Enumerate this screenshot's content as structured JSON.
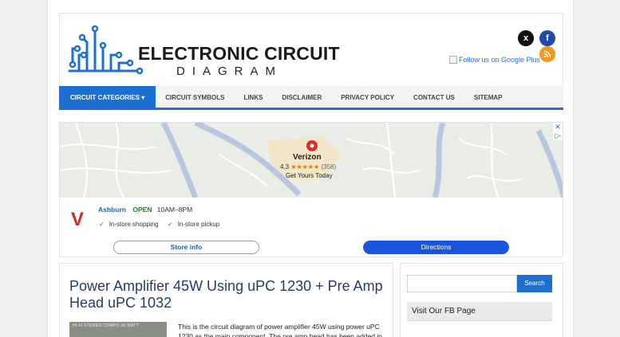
{
  "brand": {
    "title": "ELECTRONIC CIRCUIT",
    "subtitle": "DIAGRAM"
  },
  "social": {
    "twitter_icon": "x",
    "facebook_icon": "f",
    "rss_icon": "rss",
    "twitter_color": "#111111",
    "facebook_color": "#1f4aa8",
    "rss_color": "#f29a1f"
  },
  "google_plus_alt": "Follow us on Google Plus",
  "nav": [
    {
      "label": "CIRCUIT CATEGORIES ▾",
      "active": true
    },
    {
      "label": "CIRCUIT SYMBOLS"
    },
    {
      "label": "LINKS"
    },
    {
      "label": "DISCLAIMER"
    },
    {
      "label": "PRIVACY POLICY"
    },
    {
      "label": "CONTACT US"
    },
    {
      "label": "SITEMAP"
    }
  ],
  "ad": {
    "pin_label": "Verizon",
    "rating_value": "4.3",
    "rating_stars": "★★★★★",
    "rating_count": "(358)",
    "cta": "Get Yours Today",
    "brand_mark": "V",
    "city": "Ashburn",
    "status": "OPEN",
    "hours": "10AM–8PM",
    "features": [
      "In-store shopping",
      "In-store pickup"
    ],
    "check_mark": "✓",
    "store_button": "Store info",
    "directions_button": "Directions",
    "adchoices_glyphs": [
      "✕",
      "▷"
    ]
  },
  "post": {
    "title": "Power Amplifier 45W Using uPC 1230 + Pre Amp Head uPC 1032",
    "thumb_caption": "HI-FI STEREO COMPO 45 WATT",
    "excerpt": "This is the circuit diagram of power amplifier 45W using power uPC 1230 as the main component. The pre amp head has been added in"
  },
  "sidebar": {
    "search_placeholder": "",
    "search_button": "Search",
    "fb_title": "Visit Our FB Page"
  },
  "colors": {
    "accent": "#1f6fd1",
    "title_blue": "#243b6b",
    "verizon_red": "#d52b1e",
    "open_green": "#188038"
  }
}
